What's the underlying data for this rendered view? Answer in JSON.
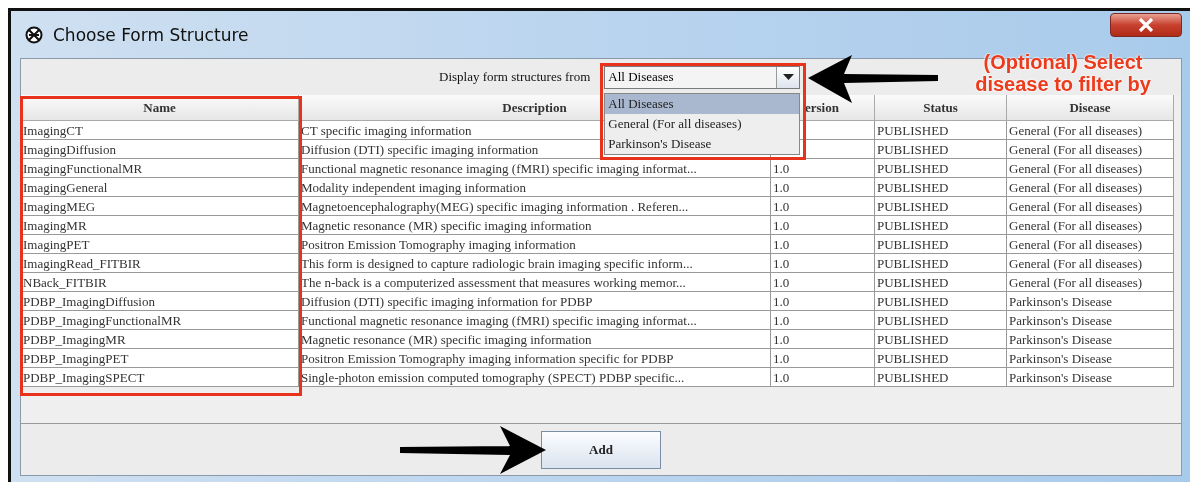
{
  "window": {
    "title": "Choose Form Structure"
  },
  "filter": {
    "label": "Display form structures from",
    "value": "All Diseases",
    "expanded": true,
    "options": [
      {
        "label": "All Diseases",
        "selected": true
      },
      {
        "label": "General (For all diseases)",
        "selected": false
      },
      {
        "label": "Parkinson's Disease",
        "selected": false
      }
    ]
  },
  "table": {
    "columns": [
      "Name",
      "Description",
      "ersion",
      "Status",
      "Disease"
    ],
    "rows": [
      {
        "name": "ImagingCT",
        "description": "CT specific imaging information",
        "status": "PUBLISHED",
        "disease": "General (For all diseases)"
      },
      {
        "name": "ImagingDiffusion",
        "description": "Diffusion (DTI) specific imaging information",
        "status": "PUBLISHED",
        "disease": "General (For all diseases)"
      },
      {
        "name": "ImagingFunctionalMR",
        "description": "Functional magnetic resonance imaging (fMRI) specific imaging informat...",
        "version": "1.0",
        "status": "PUBLISHED",
        "disease": "General (For all diseases)"
      },
      {
        "name": "ImagingGeneral",
        "description": "Modality independent imaging information",
        "version": "1.0",
        "status": "PUBLISHED",
        "disease": "General (For all diseases)"
      },
      {
        "name": "ImagingMEG",
        "description": "Magnetoencephalography(MEG) specific imaging information . Referen...",
        "version": "1.0",
        "status": "PUBLISHED",
        "disease": "General (For all diseases)"
      },
      {
        "name": "ImagingMR",
        "description": "Magnetic resonance (MR) specific imaging information",
        "version": "1.0",
        "status": "PUBLISHED",
        "disease": "General (For all diseases)"
      },
      {
        "name": "ImagingPET",
        "description": "Positron Emission Tomography imaging information",
        "version": "1.0",
        "status": "PUBLISHED",
        "disease": "General (For all diseases)"
      },
      {
        "name": "ImagingRead_FITBIR",
        "description": "This form is designed to capture radiologic brain imaging specific inform...",
        "version": "1.0",
        "status": "PUBLISHED",
        "disease": "General (For all diseases)"
      },
      {
        "name": "NBack_FITBIR",
        "description": "The n-back is a computerized assessment that measures working memor...",
        "version": "1.0",
        "status": "PUBLISHED",
        "disease": "General (For all diseases)"
      },
      {
        "name": "PDBP_ImagingDiffusion",
        "description": "Diffusion (DTI) specific imaging information for PDBP",
        "version": "1.0",
        "status": "PUBLISHED",
        "disease": "Parkinson's Disease"
      },
      {
        "name": "PDBP_ImagingFunctionalMR",
        "description": "Functional magnetic resonance imaging (fMRI) specific imaging informat...",
        "version": "1.0",
        "status": "PUBLISHED",
        "disease": "Parkinson's Disease"
      },
      {
        "name": "PDBP_ImagingMR",
        "description": "Magnetic resonance (MR) specific imaging information",
        "version": "1.0",
        "status": "PUBLISHED",
        "disease": "Parkinson's Disease"
      },
      {
        "name": "PDBP_ImagingPET",
        "description": "Positron Emission Tomography imaging information specific for PDBP",
        "version": "1.0",
        "status": "PUBLISHED",
        "disease": "Parkinson's Disease"
      },
      {
        "name": "PDBP_ImagingSPECT",
        "description": "Single-photon emission computed tomography (SPECT) PDBP specific...",
        "version": "1.0",
        "status": "PUBLISHED",
        "disease": "Parkinson's Disease"
      }
    ]
  },
  "buttons": [
    "Add"
  ],
  "annotations": {
    "callout": "(Optional) Select disease to filter by"
  }
}
